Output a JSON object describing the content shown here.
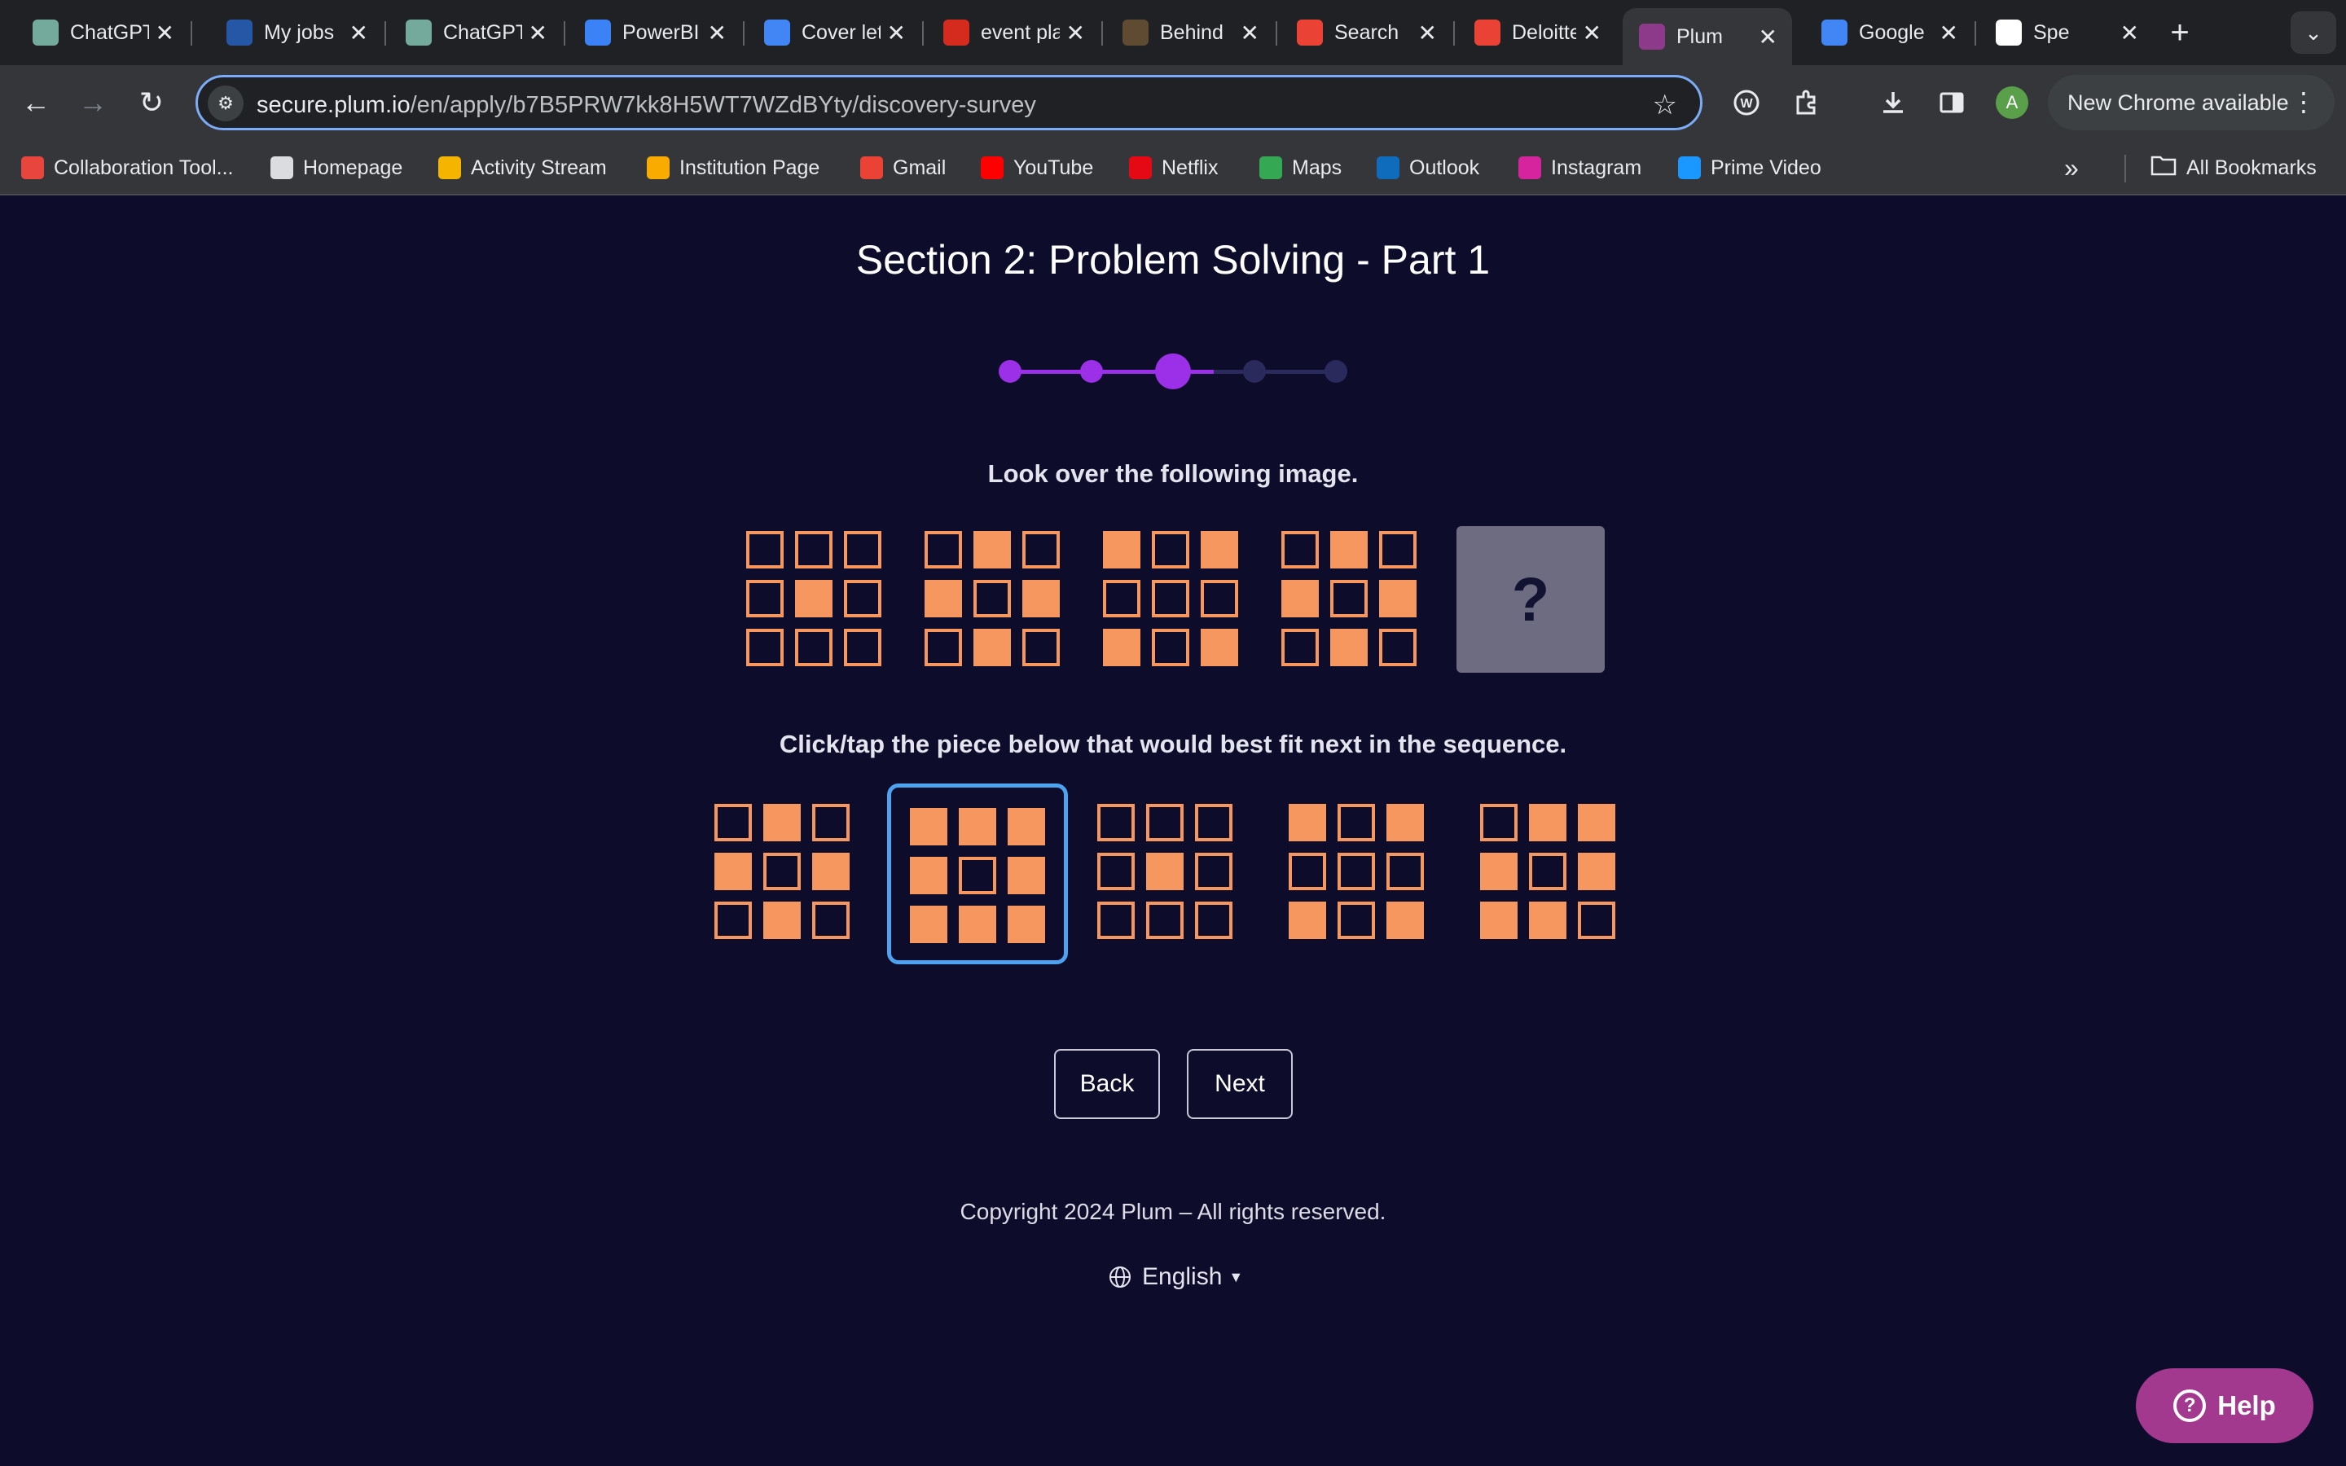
{
  "browser": {
    "tabs": [
      {
        "label": "ChatGPT",
        "icon": "chatgpt-icon",
        "color": "#74aa9c"
      },
      {
        "label": "My jobs",
        "icon": "indeed-icon",
        "color": "#2557a7"
      },
      {
        "label": "ChatGPT",
        "icon": "chatgpt-icon",
        "color": "#74aa9c"
      },
      {
        "label": "PowerBI",
        "icon": "powerbi-icon",
        "color": "#3b82f6"
      },
      {
        "label": "Cover letter",
        "icon": "docs-icon",
        "color": "#4285f4"
      },
      {
        "label": "event planning",
        "icon": "maple-leaf-icon",
        "color": "#d52b1e"
      },
      {
        "label": "Behind",
        "icon": "behind-icon",
        "color": "#5f4b32"
      },
      {
        "label": "Search",
        "icon": "gmail-icon",
        "color": "#ea4335"
      },
      {
        "label": "Deloitte",
        "icon": "gmail-icon",
        "color": "#ea4335"
      },
      {
        "label": "Plum",
        "icon": "plum-icon",
        "color": "#8e3a8a"
      },
      {
        "label": "Google",
        "icon": "google-icon",
        "color": "#4285f4"
      },
      {
        "label": "Spe",
        "icon": "speech-icon",
        "color": "#ffffff"
      }
    ],
    "active_tab": 9,
    "url_host": "secure.plum.io",
    "url_path": "/en/apply/b7B5PRW7kk8H5WT7WZdBYty/discovery-survey",
    "profile_initial": "A",
    "update_label": "New Chrome available",
    "bookmarks": [
      {
        "label": "Collaboration Tool...",
        "icon": "collaboration-icon",
        "color": "#e8453c"
      },
      {
        "label": "Homepage",
        "icon": "page-icon",
        "color": "#dadce0"
      },
      {
        "label": "Activity Stream",
        "icon": "pencil-icon",
        "color": "#f4b400"
      },
      {
        "label": "Institution Page",
        "icon": "chart-icon",
        "color": "#f9ab00"
      },
      {
        "label": "Gmail",
        "icon": "gmail-icon",
        "color": "#ea4335"
      },
      {
        "label": "YouTube",
        "icon": "youtube-icon",
        "color": "#ff0000"
      },
      {
        "label": "Netflix",
        "icon": "netflix-icon",
        "color": "#e50914"
      },
      {
        "label": "Maps",
        "icon": "maps-icon",
        "color": "#34a853"
      },
      {
        "label": "Outlook",
        "icon": "outlook-icon",
        "color": "#0f6cbd"
      },
      {
        "label": "Instagram",
        "icon": "instagram-icon",
        "color": "#d6249f"
      },
      {
        "label": "Prime Video",
        "icon": "prime-video-icon",
        "color": "#1a98ff"
      }
    ],
    "all_bookmarks_label": "All Bookmarks"
  },
  "page": {
    "title": "Section 2: Problem Solving - Part 1",
    "progress_current": 3,
    "progress_total": 5,
    "instruction": "Look over the following image.",
    "question_mark": "?",
    "options_instruction": "Click/tap the piece below that would best fit next in the sequence.",
    "sequence": [
      [
        0,
        0,
        0,
        0,
        1,
        0,
        0,
        0,
        0
      ],
      [
        0,
        1,
        0,
        1,
        0,
        1,
        0,
        1,
        0
      ],
      [
        1,
        0,
        1,
        0,
        0,
        0,
        1,
        0,
        1
      ],
      [
        0,
        1,
        0,
        1,
        0,
        1,
        0,
        1,
        0
      ]
    ],
    "options": [
      [
        0,
        1,
        0,
        1,
        0,
        1,
        0,
        1,
        0
      ],
      [
        1,
        1,
        1,
        1,
        0,
        1,
        1,
        1,
        1
      ],
      [
        0,
        0,
        0,
        0,
        1,
        0,
        0,
        0,
        0
      ],
      [
        1,
        0,
        1,
        0,
        0,
        0,
        1,
        0,
        1
      ],
      [
        0,
        1,
        1,
        1,
        0,
        1,
        1,
        1,
        0
      ]
    ],
    "selected_option": 1,
    "back_label": "Back",
    "next_label": "Next",
    "copyright": "Copyright 2024 Plum – All rights reserved.",
    "language": "English",
    "help_label": "Help",
    "colors": {
      "background": "#0d0c2b",
      "accent": "#9b30e8",
      "tile": "#f5975f",
      "selection": "#4da3f0",
      "help": "#a3388f"
    }
  }
}
